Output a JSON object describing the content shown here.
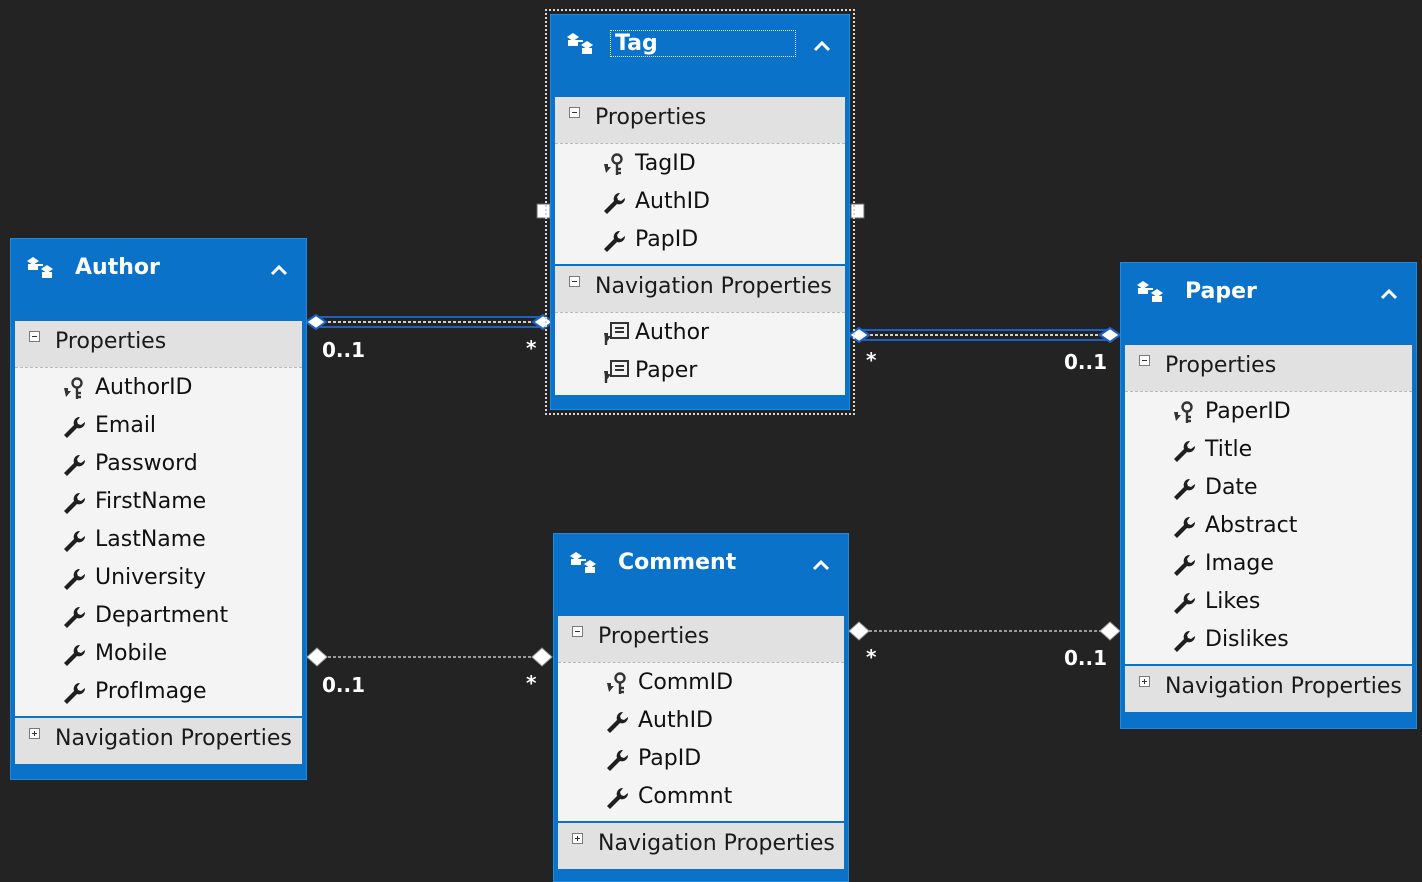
{
  "entities": {
    "author": {
      "title": "Author",
      "properties_label": "Properties",
      "properties": [
        {
          "name": "AuthorID",
          "icon": "key-icon"
        },
        {
          "name": "Email",
          "icon": "wrench-icon"
        },
        {
          "name": "Password",
          "icon": "wrench-icon"
        },
        {
          "name": "FirstName",
          "icon": "wrench-icon"
        },
        {
          "name": "LastName",
          "icon": "wrench-icon"
        },
        {
          "name": "University",
          "icon": "wrench-icon"
        },
        {
          "name": "Department",
          "icon": "wrench-icon"
        },
        {
          "name": "Mobile",
          "icon": "wrench-icon"
        },
        {
          "name": "ProfImage",
          "icon": "wrench-icon"
        }
      ],
      "nav_label": "Navigation Properties"
    },
    "tag": {
      "title": "Tag",
      "properties_label": "Properties",
      "properties": [
        {
          "name": "TagID",
          "icon": "key-icon"
        },
        {
          "name": "AuthID",
          "icon": "wrench-icon"
        },
        {
          "name": "PapID",
          "icon": "wrench-icon"
        }
      ],
      "nav_label": "Navigation Properties",
      "navigation": [
        {
          "name": "Author",
          "icon": "navigation-property-icon"
        },
        {
          "name": "Paper",
          "icon": "navigation-property-icon"
        }
      ]
    },
    "comment": {
      "title": "Comment",
      "properties_label": "Properties",
      "properties": [
        {
          "name": "CommID",
          "icon": "key-icon"
        },
        {
          "name": "AuthID",
          "icon": "wrench-icon"
        },
        {
          "name": "PapID",
          "icon": "wrench-icon"
        },
        {
          "name": "Commnt",
          "icon": "wrench-icon"
        }
      ],
      "nav_label": "Navigation Properties"
    },
    "paper": {
      "title": "Paper",
      "properties_label": "Properties",
      "properties": [
        {
          "name": "PaperID",
          "icon": "key-icon"
        },
        {
          "name": "Title",
          "icon": "wrench-icon"
        },
        {
          "name": "Date",
          "icon": "wrench-icon"
        },
        {
          "name": "Abstract",
          "icon": "wrench-icon"
        },
        {
          "name": "Image",
          "icon": "wrench-icon"
        },
        {
          "name": "Likes",
          "icon": "wrench-icon"
        },
        {
          "name": "Dislikes",
          "icon": "wrench-icon"
        }
      ],
      "nav_label": "Navigation Properties"
    }
  },
  "associations": {
    "author_tag": {
      "source": "0..1",
      "target": "*"
    },
    "tag_paper": {
      "source": "*",
      "target": "0..1"
    },
    "author_comment": {
      "source": "0..1",
      "target": "*"
    },
    "comment_paper": {
      "source": "*",
      "target": "0..1"
    }
  },
  "colors": {
    "canvas": "#232323",
    "entity_blue": "#0a73c9",
    "section_header": "#e1e1e1",
    "row_background": "#f4f4f4",
    "selected_connector": "#1f5fbf",
    "connector": "#9a9a9a"
  }
}
